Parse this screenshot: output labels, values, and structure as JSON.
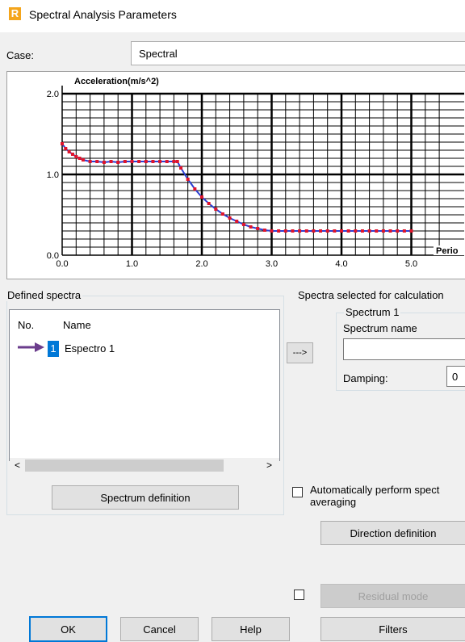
{
  "window": {
    "title": "Spectral Analysis Parameters",
    "app_icon_letter": "R"
  },
  "case": {
    "label": "Case:",
    "value": "Spectral"
  },
  "chart_data": {
    "type": "line",
    "ylabel": "Acceleration(m/s^2)",
    "xlabel": "Perio",
    "xlim": [
      0,
      5.5
    ],
    "ylim": [
      0,
      2.0
    ],
    "x_ticks": [
      "0.0",
      "1.0",
      "2.0",
      "3.0",
      "4.0",
      "5.0"
    ],
    "y_ticks": [
      "0.0",
      "1.0",
      "2.0"
    ],
    "grid": true,
    "series_color": "#e0142b",
    "line_color": "#2b3fd1",
    "x": [
      0.0,
      0.05,
      0.1,
      0.15,
      0.2,
      0.25,
      0.3,
      0.4,
      0.5,
      0.6,
      0.7,
      0.8,
      0.9,
      1.0,
      1.1,
      1.2,
      1.3,
      1.4,
      1.5,
      1.6,
      1.65,
      1.7,
      1.8,
      1.9,
      2.0,
      2.1,
      2.2,
      2.3,
      2.4,
      2.5,
      2.6,
      2.7,
      2.8,
      2.9,
      3.0,
      3.1,
      3.2,
      3.3,
      3.4,
      3.5,
      3.6,
      3.7,
      3.8,
      3.9,
      4.0,
      4.1,
      4.2,
      4.3,
      4.4,
      4.5,
      4.6,
      4.7,
      4.8,
      4.9,
      5.0
    ],
    "y": [
      1.38,
      1.32,
      1.28,
      1.25,
      1.22,
      1.2,
      1.18,
      1.16,
      1.16,
      1.15,
      1.16,
      1.15,
      1.16,
      1.16,
      1.16,
      1.16,
      1.16,
      1.16,
      1.16,
      1.16,
      1.16,
      1.08,
      0.94,
      0.82,
      0.72,
      0.64,
      0.57,
      0.51,
      0.46,
      0.42,
      0.38,
      0.35,
      0.33,
      0.31,
      0.3,
      0.3,
      0.3,
      0.3,
      0.3,
      0.3,
      0.3,
      0.3,
      0.3,
      0.3,
      0.3,
      0.3,
      0.3,
      0.3,
      0.3,
      0.3,
      0.3,
      0.3,
      0.3,
      0.3,
      0.3
    ]
  },
  "defined_spectra": {
    "title": "Defined spectra",
    "columns": [
      "No.",
      "Name"
    ],
    "rows": [
      {
        "no": "1",
        "name": "Espectro 1"
      }
    ],
    "definition_button": "Spectrum definition"
  },
  "transfer_button": "--->",
  "selected": {
    "title": "Spectra selected for calculation",
    "sub_title": "Spectrum 1",
    "name_label": "Spectrum name",
    "name_value": "",
    "damping_label": "Damping:",
    "damping_value": "0"
  },
  "auto": {
    "line1": "Automatically perform spect",
    "line2": "averaging",
    "checked": false
  },
  "direction_button": "Direction definition",
  "residual": {
    "checked": false,
    "label": "Residual mode"
  },
  "buttons": {
    "ok": "OK",
    "cancel": "Cancel",
    "help": "Help",
    "filters": "Filters"
  }
}
